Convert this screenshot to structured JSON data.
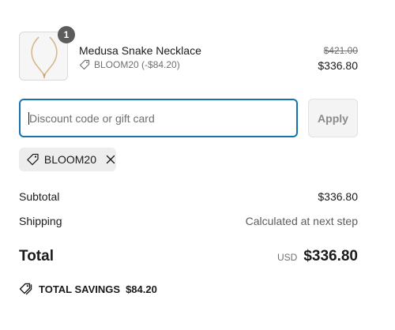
{
  "line_item": {
    "quantity": "1",
    "name": "Medusa Snake Necklace",
    "discount_label": "BLOOM20 (-$84.20)",
    "original_price": "$421.00",
    "price": "$336.80",
    "image_icon": "necklace-image"
  },
  "discount_form": {
    "placeholder": "Discount code or gift card",
    "value": "",
    "apply_label": "Apply"
  },
  "applied_code": {
    "code": "BLOOM20",
    "icon": "tag-icon",
    "remove_icon": "close-icon"
  },
  "summary": {
    "subtotal_label": "Subtotal",
    "subtotal_value": "$336.80",
    "shipping_label": "Shipping",
    "shipping_value": "Calculated at next step",
    "total_label": "Total",
    "currency": "USD",
    "total_value": "$336.80"
  },
  "savings": {
    "label": "TOTAL SAVINGS",
    "amount": "$84.20",
    "icon": "tags-icon"
  },
  "colors": {
    "accent": "#1773b0",
    "badge": "#5c5c5c",
    "muted_text": "#707070",
    "chip_bg": "#ededed"
  }
}
